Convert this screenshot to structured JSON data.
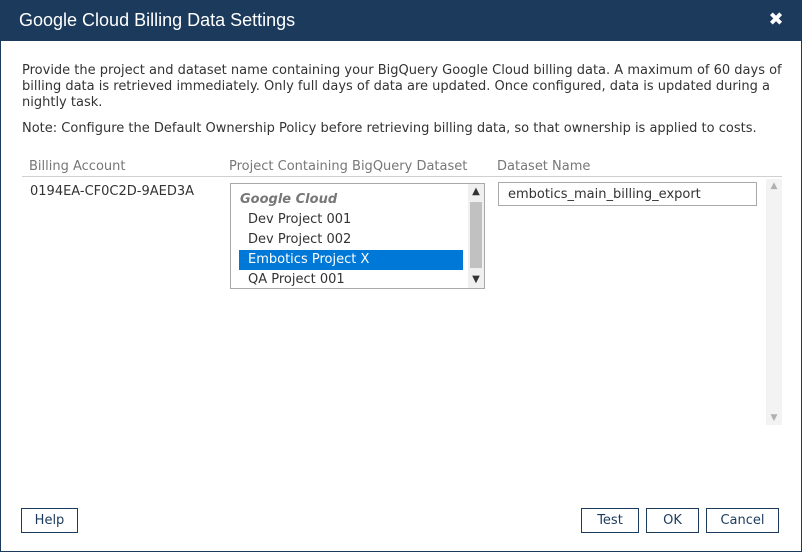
{
  "dialog": {
    "title": "Google Cloud Billing Data Settings",
    "close_glyph": "✖",
    "description": "Provide the project and dataset name containing your BigQuery Google Cloud billing data. A maximum of 60 days of billing data is retrieved immediately. Only full days of data are updated. Once configured, data is updated during a nightly task.",
    "note": "Note: Configure the Default Ownership Policy before retrieving billing data, so that ownership is applied to costs."
  },
  "columns": {
    "billing_account": "Billing Account",
    "project": "Project Containing BigQuery Dataset",
    "dataset": "Dataset Name"
  },
  "row": {
    "billing_account": "0194EA-CF0C2D-9AED3A",
    "project_group": "Google Cloud",
    "projects": [
      "Dev Project 001",
      "Dev Project 002",
      "Embotics Project X",
      "QA Project 001"
    ],
    "selected_project": "Embotics Project X",
    "dataset_value": "embotics_main_billing_export"
  },
  "buttons": {
    "help": "Help",
    "test": "Test",
    "ok": "OK",
    "cancel": "Cancel"
  },
  "colors": {
    "titlebar": "#1b3a5c",
    "selection": "#0078d7"
  }
}
